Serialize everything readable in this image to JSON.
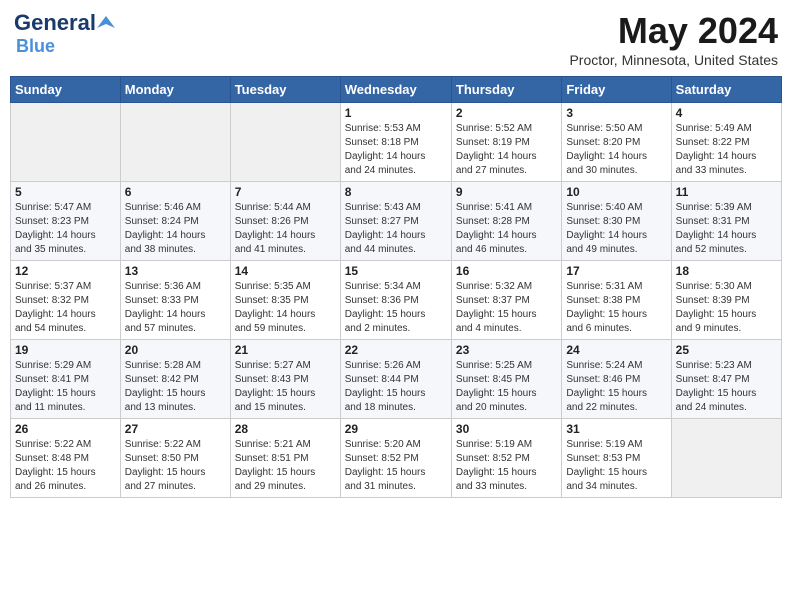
{
  "header": {
    "logo_general": "General",
    "logo_blue": "Blue",
    "month_year": "May 2024",
    "location": "Proctor, Minnesota, United States"
  },
  "weekdays": [
    "Sunday",
    "Monday",
    "Tuesday",
    "Wednesday",
    "Thursday",
    "Friday",
    "Saturday"
  ],
  "weeks": [
    [
      {
        "day": "",
        "info": ""
      },
      {
        "day": "",
        "info": ""
      },
      {
        "day": "",
        "info": ""
      },
      {
        "day": "1",
        "info": "Sunrise: 5:53 AM\nSunset: 8:18 PM\nDaylight: 14 hours\nand 24 minutes."
      },
      {
        "day": "2",
        "info": "Sunrise: 5:52 AM\nSunset: 8:19 PM\nDaylight: 14 hours\nand 27 minutes."
      },
      {
        "day": "3",
        "info": "Sunrise: 5:50 AM\nSunset: 8:20 PM\nDaylight: 14 hours\nand 30 minutes."
      },
      {
        "day": "4",
        "info": "Sunrise: 5:49 AM\nSunset: 8:22 PM\nDaylight: 14 hours\nand 33 minutes."
      }
    ],
    [
      {
        "day": "5",
        "info": "Sunrise: 5:47 AM\nSunset: 8:23 PM\nDaylight: 14 hours\nand 35 minutes."
      },
      {
        "day": "6",
        "info": "Sunrise: 5:46 AM\nSunset: 8:24 PM\nDaylight: 14 hours\nand 38 minutes."
      },
      {
        "day": "7",
        "info": "Sunrise: 5:44 AM\nSunset: 8:26 PM\nDaylight: 14 hours\nand 41 minutes."
      },
      {
        "day": "8",
        "info": "Sunrise: 5:43 AM\nSunset: 8:27 PM\nDaylight: 14 hours\nand 44 minutes."
      },
      {
        "day": "9",
        "info": "Sunrise: 5:41 AM\nSunset: 8:28 PM\nDaylight: 14 hours\nand 46 minutes."
      },
      {
        "day": "10",
        "info": "Sunrise: 5:40 AM\nSunset: 8:30 PM\nDaylight: 14 hours\nand 49 minutes."
      },
      {
        "day": "11",
        "info": "Sunrise: 5:39 AM\nSunset: 8:31 PM\nDaylight: 14 hours\nand 52 minutes."
      }
    ],
    [
      {
        "day": "12",
        "info": "Sunrise: 5:37 AM\nSunset: 8:32 PM\nDaylight: 14 hours\nand 54 minutes."
      },
      {
        "day": "13",
        "info": "Sunrise: 5:36 AM\nSunset: 8:33 PM\nDaylight: 14 hours\nand 57 minutes."
      },
      {
        "day": "14",
        "info": "Sunrise: 5:35 AM\nSunset: 8:35 PM\nDaylight: 14 hours\nand 59 minutes."
      },
      {
        "day": "15",
        "info": "Sunrise: 5:34 AM\nSunset: 8:36 PM\nDaylight: 15 hours\nand 2 minutes."
      },
      {
        "day": "16",
        "info": "Sunrise: 5:32 AM\nSunset: 8:37 PM\nDaylight: 15 hours\nand 4 minutes."
      },
      {
        "day": "17",
        "info": "Sunrise: 5:31 AM\nSunset: 8:38 PM\nDaylight: 15 hours\nand 6 minutes."
      },
      {
        "day": "18",
        "info": "Sunrise: 5:30 AM\nSunset: 8:39 PM\nDaylight: 15 hours\nand 9 minutes."
      }
    ],
    [
      {
        "day": "19",
        "info": "Sunrise: 5:29 AM\nSunset: 8:41 PM\nDaylight: 15 hours\nand 11 minutes."
      },
      {
        "day": "20",
        "info": "Sunrise: 5:28 AM\nSunset: 8:42 PM\nDaylight: 15 hours\nand 13 minutes."
      },
      {
        "day": "21",
        "info": "Sunrise: 5:27 AM\nSunset: 8:43 PM\nDaylight: 15 hours\nand 15 minutes."
      },
      {
        "day": "22",
        "info": "Sunrise: 5:26 AM\nSunset: 8:44 PM\nDaylight: 15 hours\nand 18 minutes."
      },
      {
        "day": "23",
        "info": "Sunrise: 5:25 AM\nSunset: 8:45 PM\nDaylight: 15 hours\nand 20 minutes."
      },
      {
        "day": "24",
        "info": "Sunrise: 5:24 AM\nSunset: 8:46 PM\nDaylight: 15 hours\nand 22 minutes."
      },
      {
        "day": "25",
        "info": "Sunrise: 5:23 AM\nSunset: 8:47 PM\nDaylight: 15 hours\nand 24 minutes."
      }
    ],
    [
      {
        "day": "26",
        "info": "Sunrise: 5:22 AM\nSunset: 8:48 PM\nDaylight: 15 hours\nand 26 minutes."
      },
      {
        "day": "27",
        "info": "Sunrise: 5:22 AM\nSunset: 8:50 PM\nDaylight: 15 hours\nand 27 minutes."
      },
      {
        "day": "28",
        "info": "Sunrise: 5:21 AM\nSunset: 8:51 PM\nDaylight: 15 hours\nand 29 minutes."
      },
      {
        "day": "29",
        "info": "Sunrise: 5:20 AM\nSunset: 8:52 PM\nDaylight: 15 hours\nand 31 minutes."
      },
      {
        "day": "30",
        "info": "Sunrise: 5:19 AM\nSunset: 8:52 PM\nDaylight: 15 hours\nand 33 minutes."
      },
      {
        "day": "31",
        "info": "Sunrise: 5:19 AM\nSunset: 8:53 PM\nDaylight: 15 hours\nand 34 minutes."
      },
      {
        "day": "",
        "info": ""
      }
    ]
  ]
}
